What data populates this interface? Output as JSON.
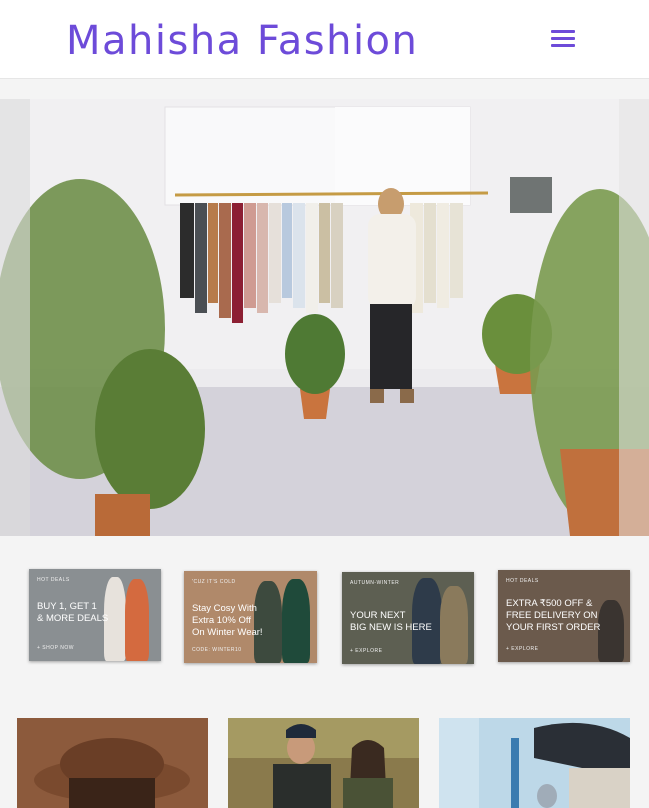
{
  "header": {
    "brand": "Mahisha Fashion",
    "menu_icon": "hamburger-menu-icon"
  },
  "hero": {
    "image": "clothing-store-interior-photo",
    "colors": {
      "wall": "#f2f1f3",
      "floor": "#d3d1d9",
      "plant": "#5b7a3a"
    }
  },
  "promos": [
    {
      "tag": "HOT DEALS",
      "lines": [
        "BUY 1, GET 1",
        "& MORE DEALS"
      ],
      "cta": "+ SHOP NOW",
      "bg": "#8a8f92"
    },
    {
      "tag": "'CUZ IT'S COLD",
      "lines": [
        "Stay Cosy With",
        "Extra 10% Off",
        "On Winter Wear!"
      ],
      "cta": "CODE: WINTER10",
      "bg": "#b0896a"
    },
    {
      "tag": "AUTUMN-WINTER",
      "lines": [
        "YOUR NEXT",
        "BIG NEW IS HERE"
      ],
      "cta": "+ EXPLORE",
      "bg": "#5d5f52"
    },
    {
      "tag": "HOT DEALS",
      "lines": [
        "EXTRA ₹500 OFF &",
        "FREE DELIVERY ON",
        "YOUR FIRST ORDER"
      ],
      "cta": "+ EXPLORE",
      "bg": "#6b5a4c"
    }
  ],
  "product_cards": [
    {
      "image": "model-with-hat-photo",
      "bg": "#8c5a3c"
    },
    {
      "image": "couple-in-jackets-photo",
      "bg": "#6e6a4c"
    },
    {
      "image": "street-store-photo",
      "bg": "#a8c4d8"
    }
  ]
}
